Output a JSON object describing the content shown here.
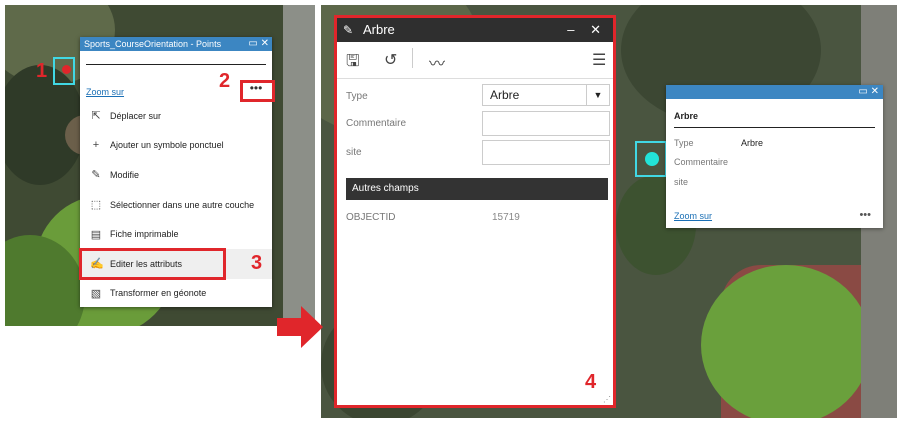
{
  "left_popup": {
    "title": "Sports_CourseOrientation - Points",
    "controls": "▭ ✕",
    "zoom_link": "Zoom sur",
    "more": "•••",
    "menu": [
      {
        "label": "Déplacer sur",
        "icon": "move-icon"
      },
      {
        "label": "Ajouter un symbole ponctuel",
        "icon": "plus-icon"
      },
      {
        "label": "Modifie",
        "icon": "pencil-icon"
      },
      {
        "label": "Sélectionner dans une autre couche",
        "icon": "select-icon"
      },
      {
        "label": "Fiche imprimable",
        "icon": "document-icon"
      },
      {
        "label": "Editer les attributs",
        "icon": "edit-icon"
      },
      {
        "label": "Transformer en géonote",
        "icon": "geonote-icon"
      }
    ]
  },
  "steps": {
    "one": "1",
    "two": "2",
    "three": "3",
    "four": "4"
  },
  "panel": {
    "title": "Arbre",
    "controls": "– ✕",
    "toolbar": {
      "save": "🖫",
      "undo": "↺",
      "geometry": "〰",
      "menu": "☰"
    },
    "type_label": "Type",
    "type_value": "Arbre",
    "comment_label": "Commentaire",
    "site_label": "site",
    "section": "Autres champs",
    "objectid_label": "OBJECTID",
    "objectid_value": "15719"
  },
  "right_popup": {
    "controls": "▭ ✕",
    "title": "Arbre",
    "type_label": "Type",
    "type_value": "Arbre",
    "comment_label": "Commentaire",
    "site_label": "site",
    "zoom_link": "Zoom sur",
    "more": "•••"
  },
  "colors": {
    "accent": "#e0262b",
    "header_blue": "#3c86c2",
    "dark_header": "#2f2f2f",
    "highlight": "#41d8e4"
  }
}
